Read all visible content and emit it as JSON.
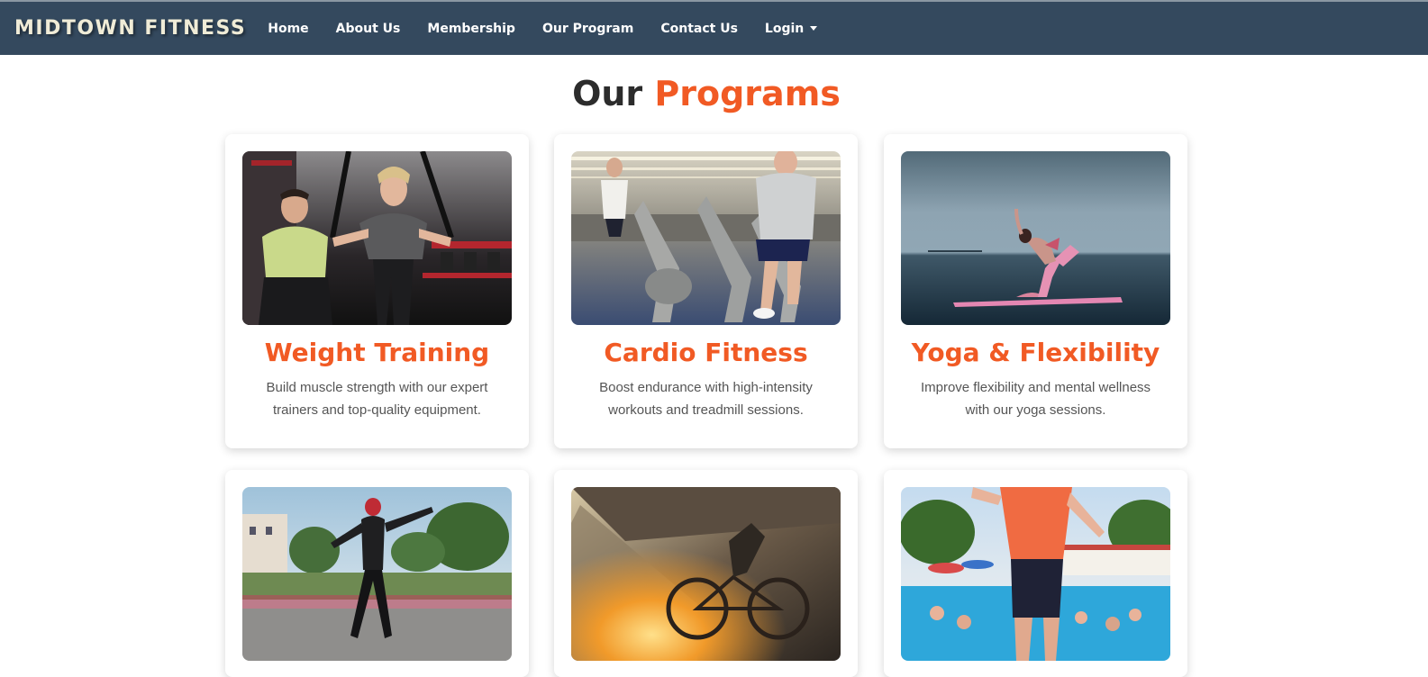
{
  "brand": "MIDTOWN FITNESS",
  "nav": {
    "items": [
      {
        "label": "Home"
      },
      {
        "label": "About Us"
      },
      {
        "label": "Membership"
      },
      {
        "label": "Our Program"
      },
      {
        "label": "Contact Us"
      },
      {
        "label": "Login"
      }
    ]
  },
  "heading": {
    "part1": "Our ",
    "part2": "Programs"
  },
  "programs": [
    {
      "title": "Weight Training",
      "desc": "Build muscle strength with our expert trainers and top-quality equipment."
    },
    {
      "title": "Cardio Fitness",
      "desc": "Boost endurance with high-intensity workouts and treadmill sessions."
    },
    {
      "title": "Yoga & Flexibility",
      "desc": "Improve flexibility and mental wellness with our yoga sessions."
    }
  ],
  "colors": {
    "navbar": "#34495e",
    "accent": "#f15a24",
    "brand_text": "#f0ecd7"
  }
}
